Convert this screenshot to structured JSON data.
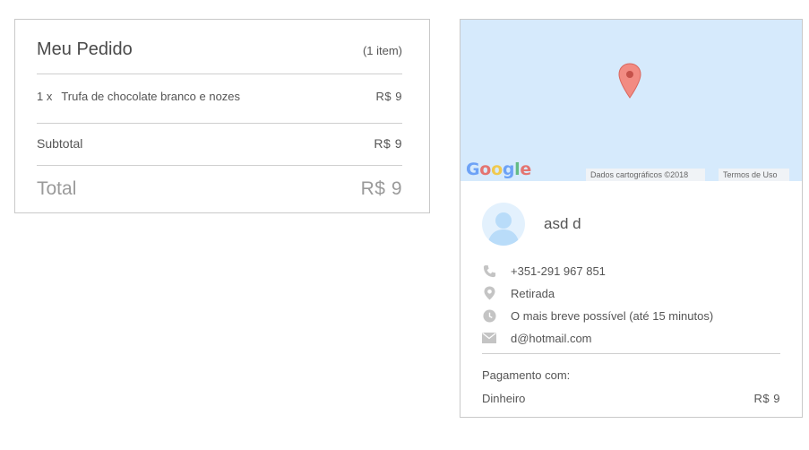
{
  "order": {
    "title": "Meu Pedido",
    "item_count": "(1 item)",
    "items": [
      {
        "qty": "1 x",
        "name": "Trufa de chocolate branco e nozes",
        "price": "R$ 9"
      }
    ],
    "subtotal_label": "Subtotal",
    "subtotal_value": "R$ 9",
    "total_label": "Total",
    "total_value": "R$ 9"
  },
  "map": {
    "logo_text": "Google",
    "data_credit": "Dados cartográficos ©2018",
    "terms_link": "Termos de Uso",
    "colors": {
      "water": "#d6eafc",
      "pin": "#f28b82"
    }
  },
  "customer": {
    "name": "asd d",
    "phone": "+351-291 967 851",
    "delivery_method": "Retirada",
    "time": "O mais breve possível (até 15 minutos)",
    "email": "d@hotmail.com",
    "icons": [
      "phone-icon",
      "location-icon",
      "clock-icon",
      "email-icon"
    ]
  },
  "payment": {
    "label": "Pagamento com:",
    "method": "Dinheiro",
    "amount": "R$ 9"
  }
}
